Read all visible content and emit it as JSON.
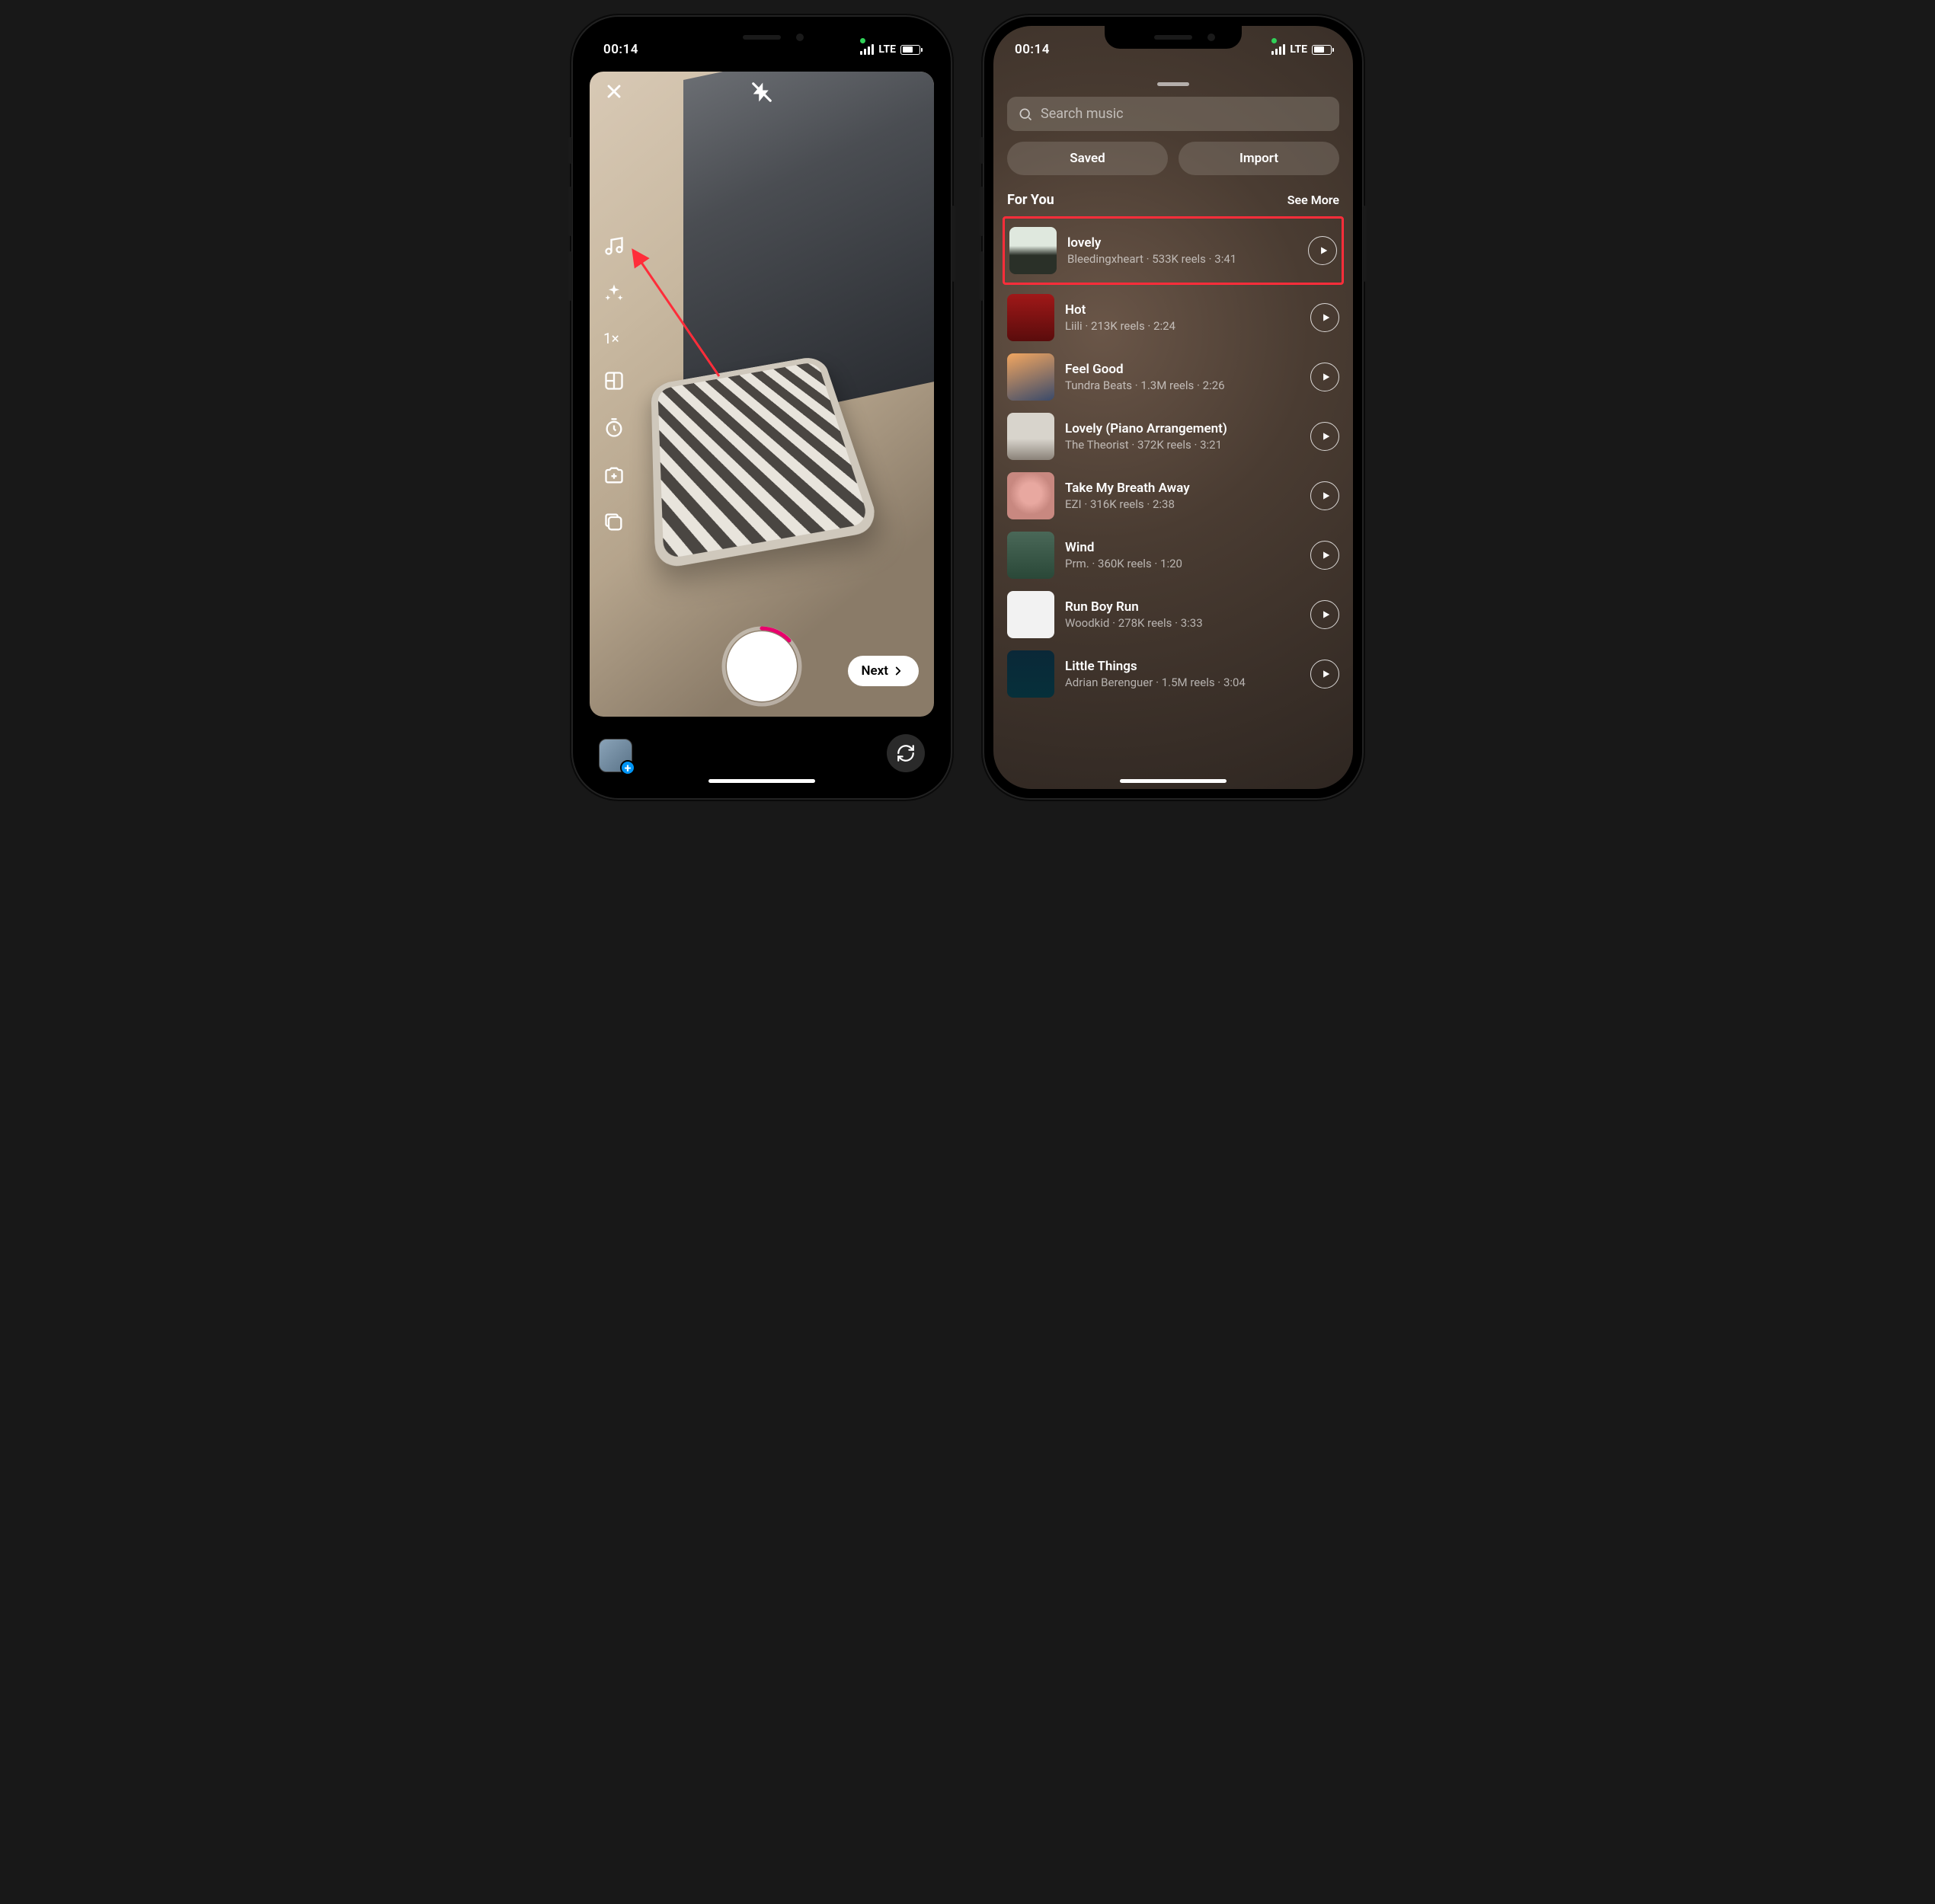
{
  "statusBar": {
    "time": "00:14",
    "network": "LTE"
  },
  "leftPhone": {
    "nextLabel": "Next",
    "speedLabel": "1×",
    "toolIcons": [
      "music-note-icon",
      "sparkle-icon",
      "speed-1x",
      "layout-icon",
      "timer-icon",
      "camera-plus-icon",
      "multi-capture-icon"
    ]
  },
  "rightPhone": {
    "searchPlaceholder": "Search music",
    "savedLabel": "Saved",
    "importLabel": "Import",
    "sectionTitle": "For You",
    "seeMoreLabel": "See More",
    "tracks": [
      {
        "title": "lovely",
        "artist": "Bleedingxheart",
        "reels": "533K reels",
        "duration": "3:41",
        "highlighted": true
      },
      {
        "title": "Hot",
        "artist": "Liili",
        "reels": "213K reels",
        "duration": "2:24"
      },
      {
        "title": "Feel Good",
        "artist": "Tundra Beats",
        "reels": "1.3M reels",
        "duration": "2:26"
      },
      {
        "title": "Lovely (Piano Arrangement)",
        "artist": "The Theorist",
        "reels": "372K reels",
        "duration": "3:21"
      },
      {
        "title": "Take My Breath Away",
        "artist": "EZI",
        "reels": "316K reels",
        "duration": "2:38"
      },
      {
        "title": "Wind",
        "artist": "Prm.",
        "reels": "360K reels",
        "duration": "1:20"
      },
      {
        "title": "Run Boy Run",
        "artist": "Woodkid",
        "reels": "278K reels",
        "duration": "3:33"
      },
      {
        "title": "Little Things",
        "artist": "Adrian Berenguer",
        "reels": "1.5M reels",
        "duration": "3:04"
      }
    ]
  }
}
